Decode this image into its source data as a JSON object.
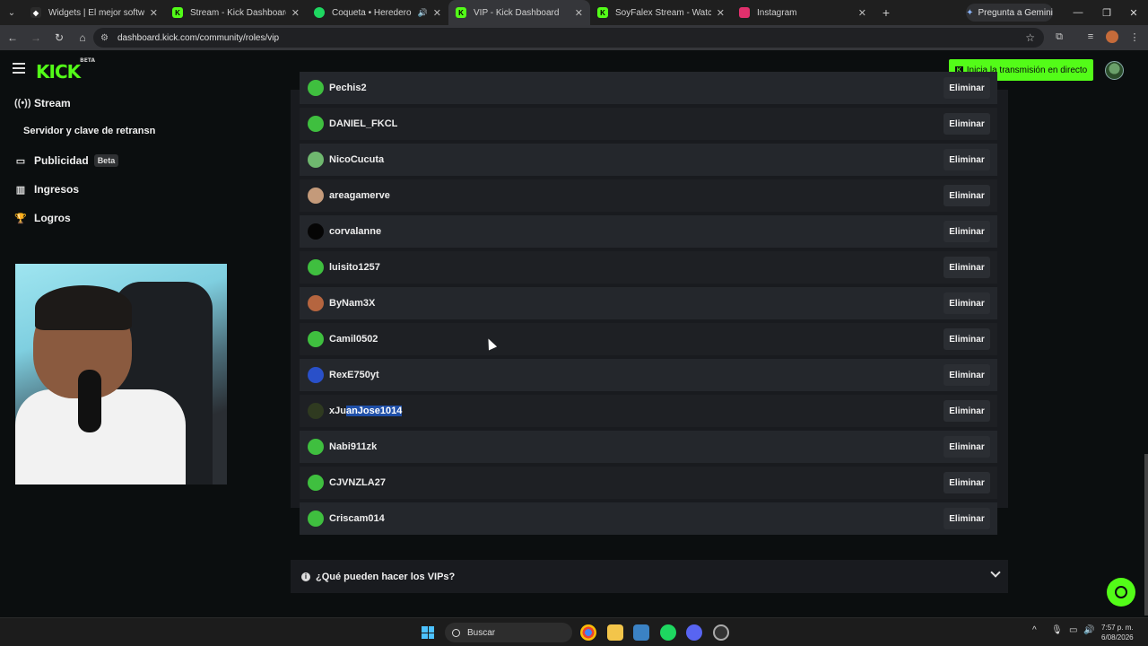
{
  "browser": {
    "tabs": [
      {
        "title": "Widgets | El mejor software par",
        "favicon_color": "#2b2b2b",
        "active": false
      },
      {
        "title": "Stream - Kick Dashboard",
        "favicon_color": "#53fc18",
        "active": false
      },
      {
        "title": "Coqueta • Heredero",
        "favicon_color": "#1ed760",
        "active": false
      },
      {
        "title": "VIP - Kick Dashboard",
        "favicon_color": "#53fc18",
        "active": true
      },
      {
        "title": "SoyFalex Stream - Watch Live o",
        "favicon_color": "#53fc18",
        "active": false
      },
      {
        "title": "Instagram",
        "favicon_color": "#e1306c",
        "active": false
      }
    ],
    "gemini_label": "Pregunta a Gemini",
    "url": "dashboard.kick.com/community/roles/vip"
  },
  "header": {
    "logo": "KICK",
    "logo_tag": "BETA",
    "go_live_label": "Inicia la transmisión en directo"
  },
  "sidebar": {
    "items": [
      {
        "label": "Stream",
        "icon": "broadcast-icon"
      },
      {
        "label": "Servidor y clave de retransn",
        "icon": ""
      },
      {
        "label": "Publicidad",
        "icon": "ads-icon",
        "badge": "Beta"
      },
      {
        "label": "Ingresos",
        "icon": "chart-icon"
      },
      {
        "label": "Logros",
        "icon": "trophy-icon"
      }
    ]
  },
  "vip_list": {
    "remove_label": "Eliminar",
    "users": [
      {
        "name": "Pechis2",
        "avatar_color": "#3fbf3f"
      },
      {
        "name": "DANIEL_FKCL",
        "avatar_color": "#3fbf3f"
      },
      {
        "name": "NicoCucuta",
        "avatar_color": "#6fb86f"
      },
      {
        "name": "areagamerve",
        "avatar_color": "#c49a7a"
      },
      {
        "name": "corvalanne",
        "avatar_color": "#050505"
      },
      {
        "name": "luisito1257",
        "avatar_color": "#3fbf3f"
      },
      {
        "name": "ByNam3X",
        "avatar_color": "#b5653f"
      },
      {
        "name": "Camil0502",
        "avatar_color": "#3fbf3f"
      },
      {
        "name": "RexE750yt",
        "avatar_color": "#2950c9"
      },
      {
        "name": "xJuanJose1014",
        "name_plain": "xJu",
        "name_selected": "anJose1014",
        "avatar_color": "#2f3a20"
      },
      {
        "name": "Nabi911zk",
        "avatar_color": "#3fbf3f"
      },
      {
        "name": "CJVNZLA27",
        "avatar_color": "#3fbf3f"
      },
      {
        "name": "Criscam014",
        "avatar_color": "#3fbf3f"
      }
    ]
  },
  "faq": {
    "question": "¿Qué pueden hacer los VIPs?"
  },
  "taskbar": {
    "search_label": "Buscar",
    "time": "7:57 p. m.",
    "date": "6/08/2026"
  },
  "colors": {
    "brand": "#53fc18",
    "background": "#0b0e0f",
    "panel": "#191b1f"
  }
}
